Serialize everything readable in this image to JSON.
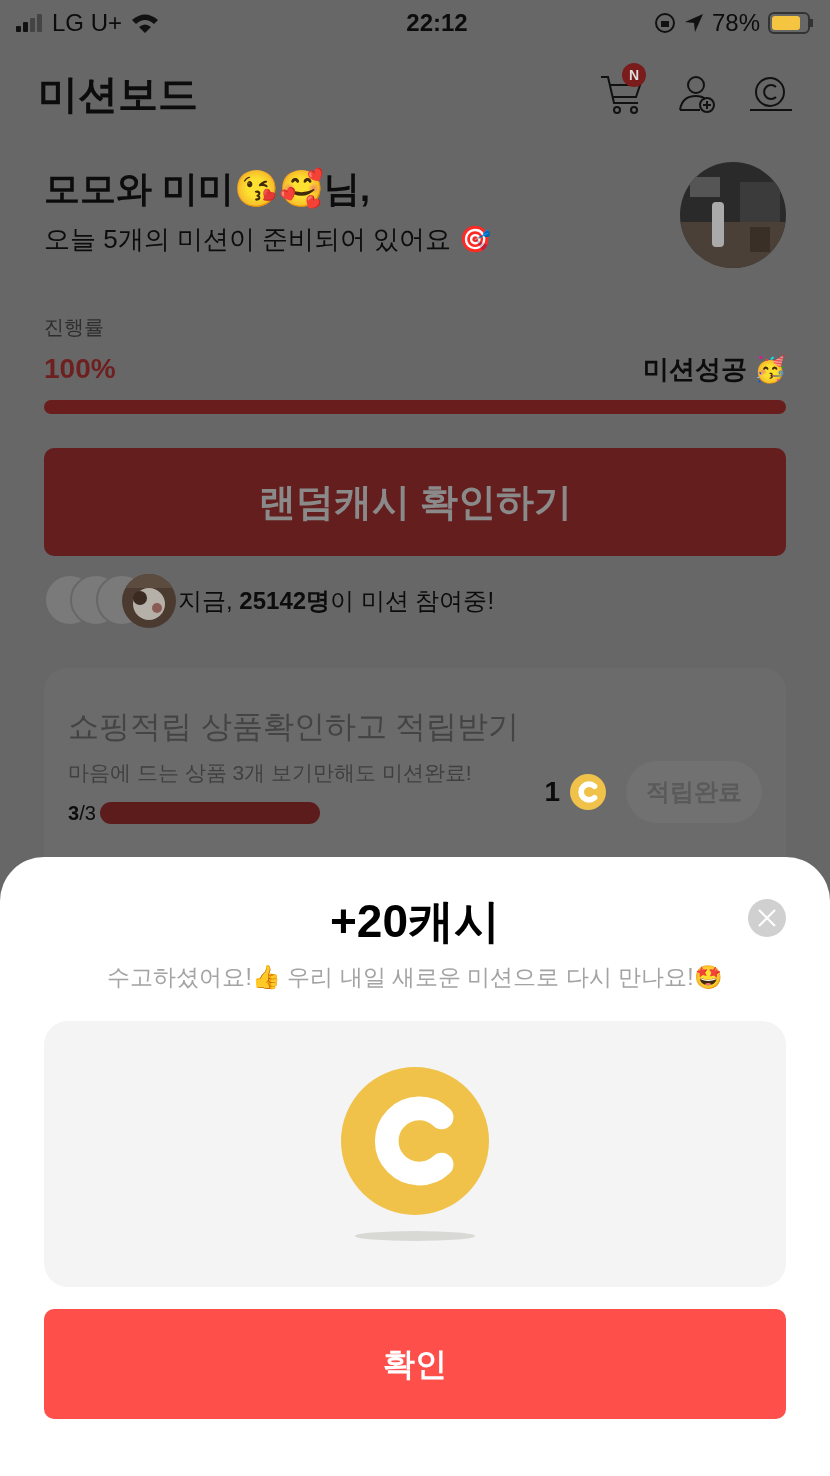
{
  "status_bar": {
    "carrier": "LG U+",
    "time": "22:12",
    "battery": "78%"
  },
  "header": {
    "title": "미션보드",
    "cart_badge": "N"
  },
  "greeting": {
    "name": "모모와 미미😘🥰님,",
    "subtitle": "오늘 5개의 미션이 준비되어 있어요 🎯"
  },
  "progress": {
    "label": "진행률",
    "percent": "100%",
    "status": "미션성공 🥳"
  },
  "random_cash_button": {
    "label": "랜덤캐시 확인하기"
  },
  "participants": {
    "text": "지금, **25142명**이 미션 참여중!"
  },
  "mission": {
    "title": "쇼핑적립 상품확인하고 적립받기",
    "description": "마음에 드는 상품 3개 보기만해도 미션완료!",
    "reward": "1",
    "button": "적립완료",
    "count": "**3**/3"
  },
  "modal": {
    "title": "+20캐시",
    "message": "수고하셨어요!👍 우리 내일 새로운 미션으로 다시 만나요!🤩",
    "confirm": "확인"
  }
}
